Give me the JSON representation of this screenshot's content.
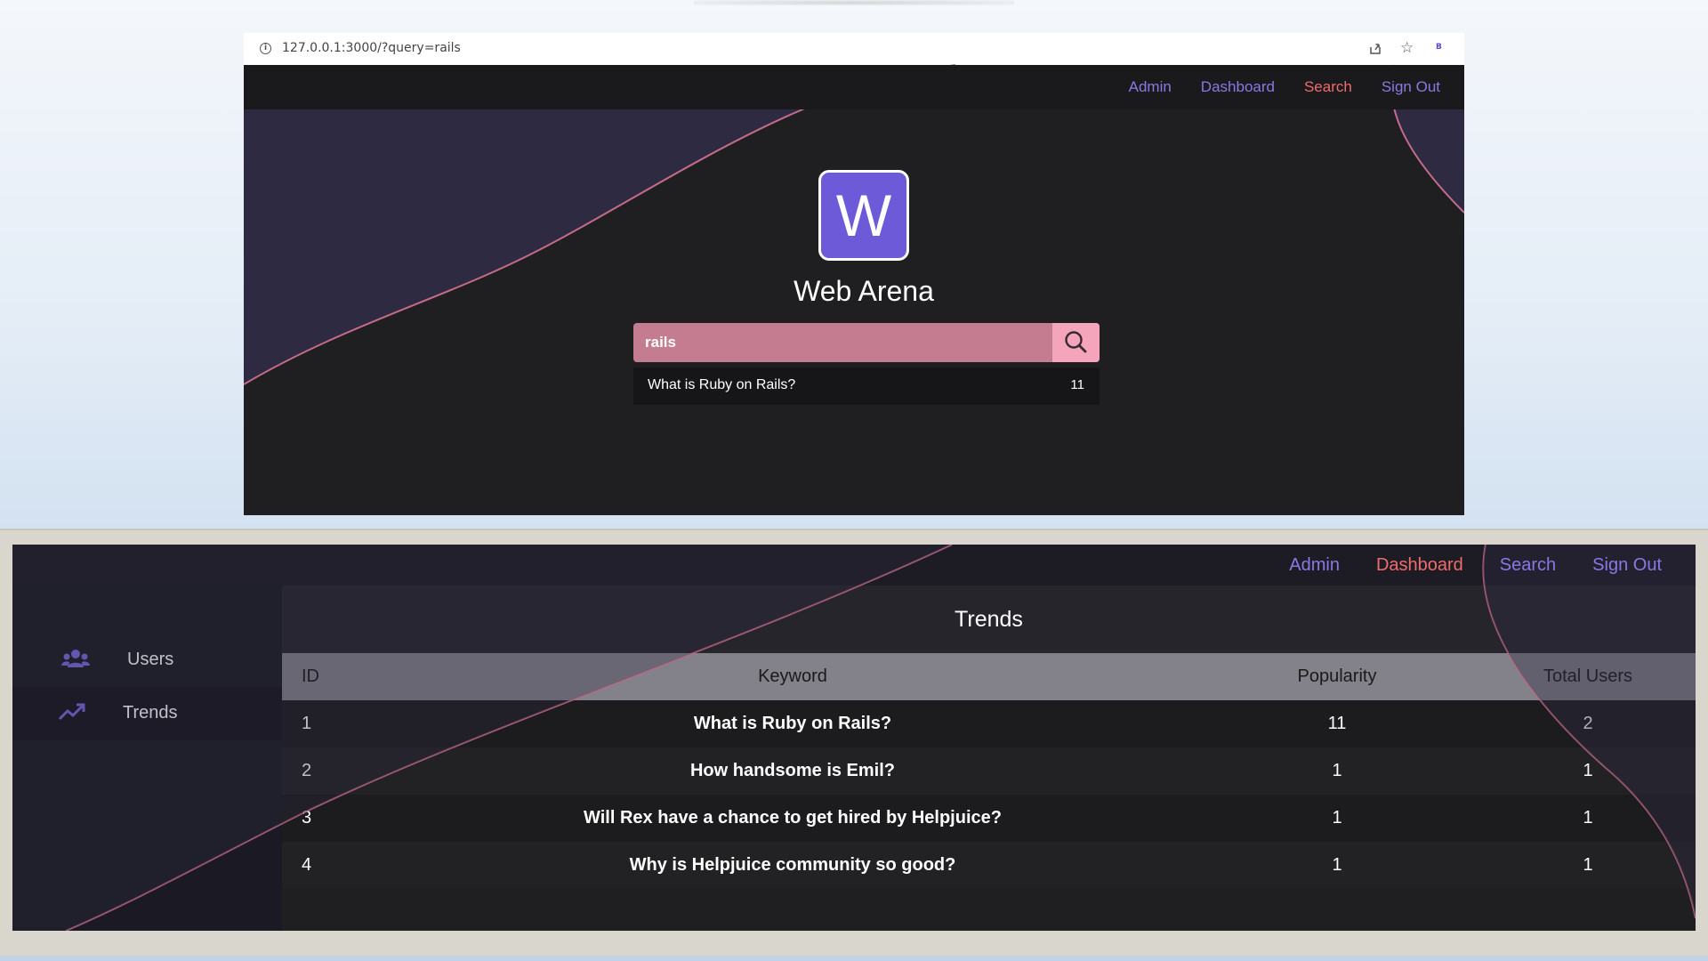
{
  "top_window": {
    "url": "127.0.0.1:3000/?query=rails",
    "profile_initial": "B",
    "nav": [
      "Admin",
      "Dashboard",
      "Search",
      "Sign Out"
    ],
    "active_nav": "Search",
    "logo_letter": "W",
    "brand": "Web Arena",
    "search": {
      "value": "rails"
    },
    "results": [
      {
        "query": "What is Ruby on Rails?",
        "count": "11"
      }
    ]
  },
  "bottom_window": {
    "nav": [
      "Admin",
      "Dashboard",
      "Search",
      "Sign Out"
    ],
    "active_nav": "Dashboard",
    "sidebar": [
      {
        "label": "Users",
        "icon": "users-icon"
      },
      {
        "label": "Trends",
        "icon": "trending-up-icon",
        "selected": true
      }
    ],
    "title": "Trends",
    "table": {
      "headers": [
        "ID",
        "Keyword",
        "Popularity",
        "Total Users"
      ],
      "rows": [
        [
          "1",
          "What is Ruby on Rails?",
          "11",
          "2"
        ],
        [
          "2",
          "How handsome is Emil?",
          "1",
          "1"
        ],
        [
          "3",
          "Will Rex have a chance to get hired by Helpjuice?",
          "1",
          "1"
        ],
        [
          "4",
          "Why is Helpjuice community so good?",
          "1",
          "1"
        ]
      ]
    }
  },
  "colors": {
    "accent": "#6d5ad8",
    "nav_link": "#8a78e4",
    "nav_active": "#f06b6b",
    "search_bg": "#c47d90",
    "search_button": "#f4a5bc",
    "app_bg": "#1f1f21"
  }
}
